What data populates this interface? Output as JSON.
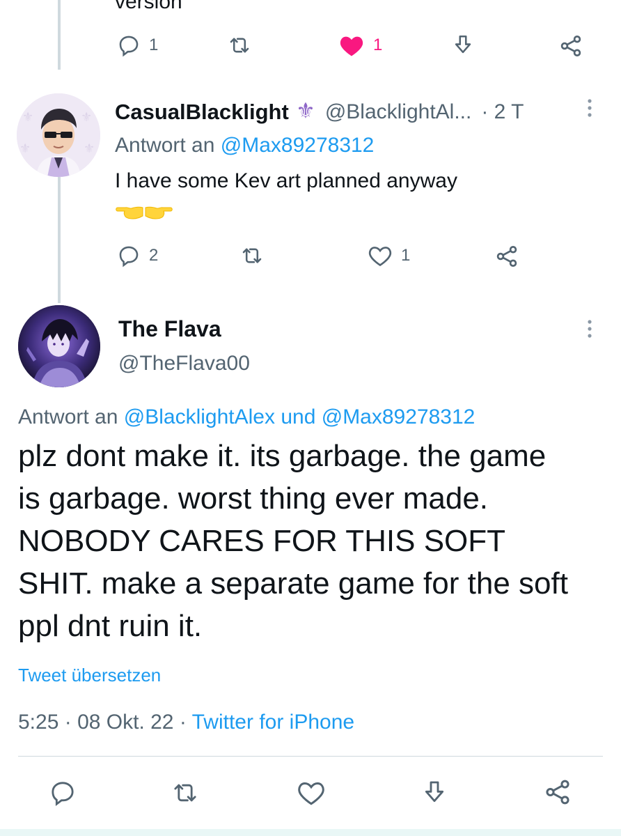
{
  "prev_tweet": {
    "text_fragment": "version",
    "reply_count": "1",
    "like_count": "1",
    "colors": {
      "like_active": "#f91880"
    }
  },
  "reply": {
    "display_name": "CasualBlacklight",
    "badge_icon": "fleur-de-lis-icon",
    "handle": "@BlacklightAl...",
    "time": "· 2 T",
    "replying_prefix": "Antwort an",
    "replying_to": "@Max89278312",
    "text": "I have some Kev art planned anyway",
    "emoji_icons": [
      "pointing-left-hand-icon",
      "pointing-right-hand-icon"
    ],
    "reply_count": "2",
    "like_count": "1"
  },
  "main_tweet": {
    "display_name": "The Flava",
    "handle": "@TheFlava00",
    "replying_prefix": "Antwort an",
    "replying_to_1": "@BlacklightAlex",
    "replying_conjunction": "und",
    "replying_to_2": "@Max89278312",
    "text": "plz dont make it. its garbage. the game is garbage. worst thing ever made. NOBODY CARES FOR THIS SOFT SHIT. make a separate game for the soft ppl dnt ruin it.",
    "translate_label": "Tweet übersetzen",
    "time": "5:25",
    "date": "08 Okt. 22",
    "source": "Twitter for iPhone",
    "separator": "·"
  },
  "colors": {
    "link": "#1d9bf0",
    "muted": "#536471",
    "text": "#0f1419",
    "thread_line": "#cfd9de"
  }
}
